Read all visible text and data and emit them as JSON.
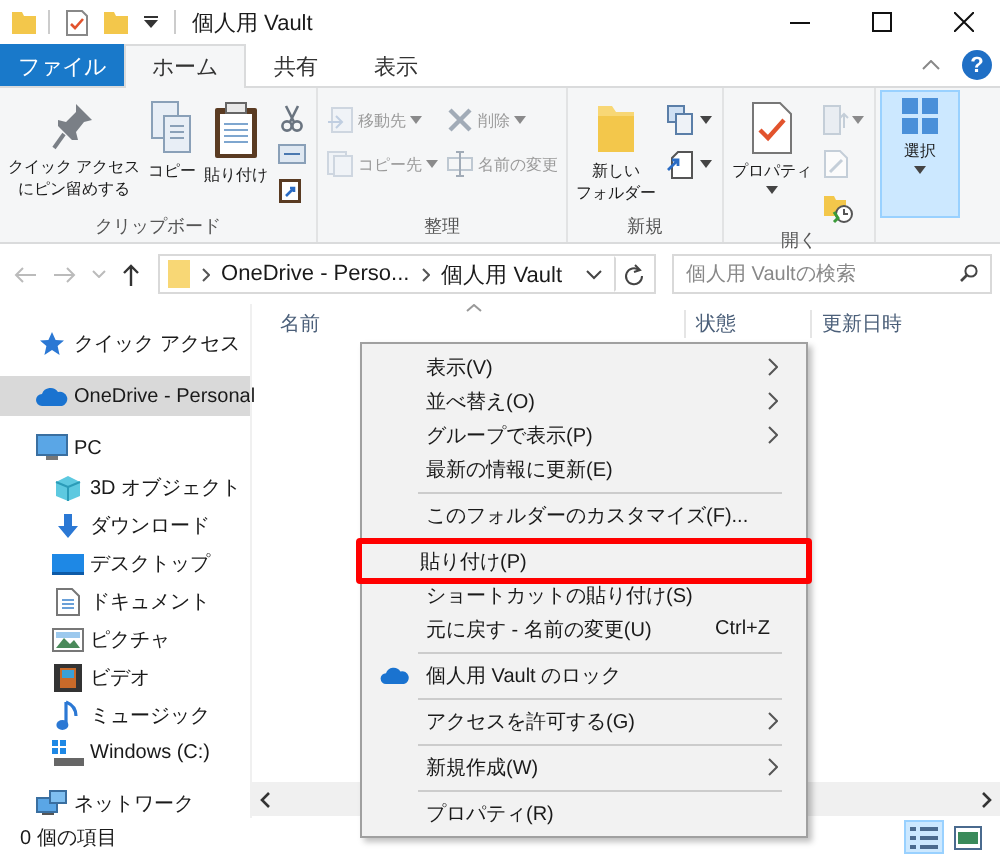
{
  "window": {
    "title": "個人用 Vault"
  },
  "ribbon_tabs": [
    {
      "label": "ファイル",
      "kind": "file",
      "selected": false
    },
    {
      "label": "ホーム",
      "kind": "tab",
      "selected": true
    },
    {
      "label": "共有",
      "kind": "tab",
      "selected": false
    },
    {
      "label": "表示",
      "kind": "tab",
      "selected": false
    }
  ],
  "help": "?",
  "ribbon_groups": [
    {
      "label": "クリップボード",
      "commands": [
        {
          "kind": "large",
          "lines": [
            "クイック アクセス",
            "にピン留めする"
          ],
          "disabled": false,
          "dropdown": false,
          "pressed": false
        },
        {
          "kind": "large",
          "lines": [
            "コピー"
          ],
          "disabled": false,
          "dropdown": false,
          "pressed": false
        },
        {
          "kind": "large",
          "lines": [
            "貼り付け"
          ],
          "disabled": false,
          "dropdown": false,
          "pressed": false
        },
        {
          "kind": "icon",
          "disabled": false,
          "dropdown": false,
          "pressed": false
        },
        {
          "kind": "icon",
          "disabled": false,
          "dropdown": false,
          "pressed": false
        },
        {
          "kind": "icon",
          "disabled": false,
          "dropdown": false,
          "pressed": false
        }
      ]
    },
    {
      "label": "整理",
      "commands": [
        {
          "kind": "small",
          "label": "移動先",
          "disabled": true,
          "dropdown": true,
          "pressed": false
        },
        {
          "kind": "small",
          "label": "コピー先",
          "disabled": true,
          "dropdown": true,
          "pressed": false
        },
        {
          "kind": "small",
          "label": "削除",
          "disabled": true,
          "dropdown": true,
          "pressed": false
        },
        {
          "kind": "small",
          "label": "名前の変更",
          "disabled": true,
          "dropdown": false,
          "pressed": false
        }
      ]
    },
    {
      "label": "新規",
      "commands": [
        {
          "kind": "large",
          "lines": [
            "新しい",
            "フォルダー"
          ],
          "disabled": false,
          "dropdown": false,
          "pressed": false
        },
        {
          "kind": "icon",
          "disabled": false,
          "dropdown": true,
          "pressed": false
        },
        {
          "kind": "icon",
          "disabled": false,
          "dropdown": true,
          "pressed": false
        }
      ]
    },
    {
      "label": "開く",
      "commands": [
        {
          "kind": "large",
          "lines": [
            "プロパティ"
          ],
          "disabled": false,
          "dropdown": true,
          "pressed": false
        },
        {
          "kind": "icon",
          "disabled": true,
          "dropdown": true,
          "pressed": false
        },
        {
          "kind": "icon",
          "disabled": true,
          "dropdown": false,
          "pressed": false
        },
        {
          "kind": "icon",
          "disabled": false,
          "dropdown": false,
          "pressed": false
        }
      ]
    },
    {
      "commands": [
        {
          "kind": "large",
          "lines": [
            "選択"
          ],
          "disabled": false,
          "dropdown": true,
          "pressed": true
        }
      ]
    }
  ],
  "address": {
    "breadcrumbs": [
      "OneDrive - Perso...",
      "個人用 Vault"
    ]
  },
  "search": {
    "placeholder": "個人用 Vaultの検索"
  },
  "navigation": [
    {
      "label": "クイック アクセス",
      "selected": false
    },
    {
      "label": "OneDrive - Personal",
      "selected": true
    },
    {
      "label": "PC",
      "selected": false,
      "children": [
        {
          "label": "3D オブジェクト",
          "selected": false
        },
        {
          "label": "ダウンロード",
          "selected": false
        },
        {
          "label": "デスクトップ",
          "selected": false
        },
        {
          "label": "ドキュメント",
          "selected": false
        },
        {
          "label": "ピクチャ",
          "selected": false
        },
        {
          "label": "ビデオ",
          "selected": false
        },
        {
          "label": "ミュージック",
          "selected": false
        },
        {
          "label": "Windows (C:)",
          "selected": false
        }
      ]
    },
    {
      "label": "ネットワーク",
      "selected": false
    }
  ],
  "columns": [
    "名前",
    "状態",
    "更新日時"
  ],
  "context_menu": {
    "sections": [
      [
        {
          "label": "表示(V)",
          "kind": "text",
          "submenu": true,
          "highlighted": false
        },
        {
          "label": "並べ替え(O)",
          "kind": "text",
          "submenu": true,
          "highlighted": false
        },
        {
          "label": "グループで表示(P)",
          "kind": "text",
          "submenu": true,
          "highlighted": false
        },
        {
          "label": "最新の情報に更新(E)",
          "kind": "text",
          "submenu": false,
          "highlighted": false
        }
      ],
      [
        {
          "label": "このフォルダーのカスタマイズ(F)...",
          "kind": "text",
          "submenu": false,
          "highlighted": false
        }
      ],
      [
        {
          "label": "貼り付け(P)",
          "kind": "text",
          "submenu": false,
          "highlighted": true
        },
        {
          "label": "ショートカットの貼り付け(S)",
          "kind": "text",
          "submenu": false,
          "highlighted": false
        },
        {
          "label": "元に戻す - 名前の変更(U)",
          "kind": "text",
          "submenu": false,
          "highlighted": false,
          "shortcut": "Ctrl+Z"
        }
      ],
      [
        {
          "label": "個人用 Vault のロック",
          "kind": "icon",
          "submenu": false,
          "highlighted": false
        }
      ],
      [
        {
          "label": "アクセスを許可する(G)",
          "kind": "text",
          "submenu": true,
          "highlighted": false
        }
      ],
      [
        {
          "label": "新規作成(W)",
          "kind": "text",
          "submenu": true,
          "highlighted": false
        }
      ],
      [
        {
          "label": "プロパティ(R)",
          "kind": "text",
          "submenu": false,
          "highlighted": false
        }
      ]
    ]
  },
  "status_bar": {
    "text": "0 個の項目",
    "views": [
      {
        "selected": true
      },
      {
        "selected": false
      }
    ]
  }
}
